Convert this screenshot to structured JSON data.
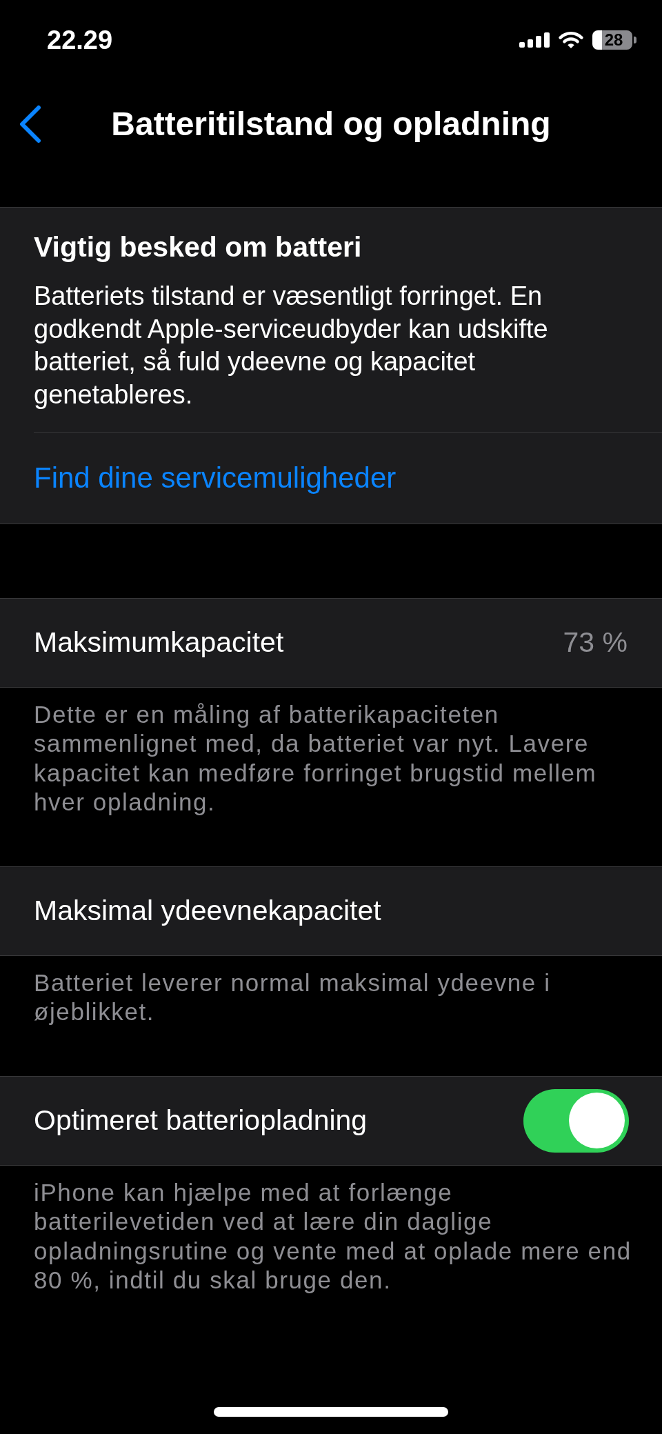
{
  "status_bar": {
    "time": "22.29",
    "battery": "28"
  },
  "nav": {
    "title": "Batteritilstand og opladning"
  },
  "notice": {
    "title": "Vigtig besked om batteri",
    "message": "Batteriets tilstand er væsentligt forringet. En godkendt Apple-serviceudbyder kan udskifte batteriet, så fuld ydeevne og kapacitet genetableres.",
    "link": "Find dine servicemuligheder"
  },
  "sections": [
    {
      "kind": "value",
      "label": "Maksimumkapacitet",
      "value": "73 %",
      "footer": "Dette er en måling af batterikapaciteten sammenlignet med, da batteriet var nyt. Lavere kapacitet kan medføre forringet brugstid mellem hver opladning."
    },
    {
      "kind": "plain",
      "label": "Maksimal ydeevnekapacitet",
      "footer": "Batteriet leverer normal maksimal ydeevne i øjeblikket."
    },
    {
      "kind": "toggle",
      "label": "Optimeret batteriopladning",
      "on": true,
      "footer": "iPhone kan hjælpe med at forlænge batterilevetiden ved at lære din daglige opladningsrutine og vente med at oplade mere end 80 %, indtil du skal bruge den."
    }
  ]
}
